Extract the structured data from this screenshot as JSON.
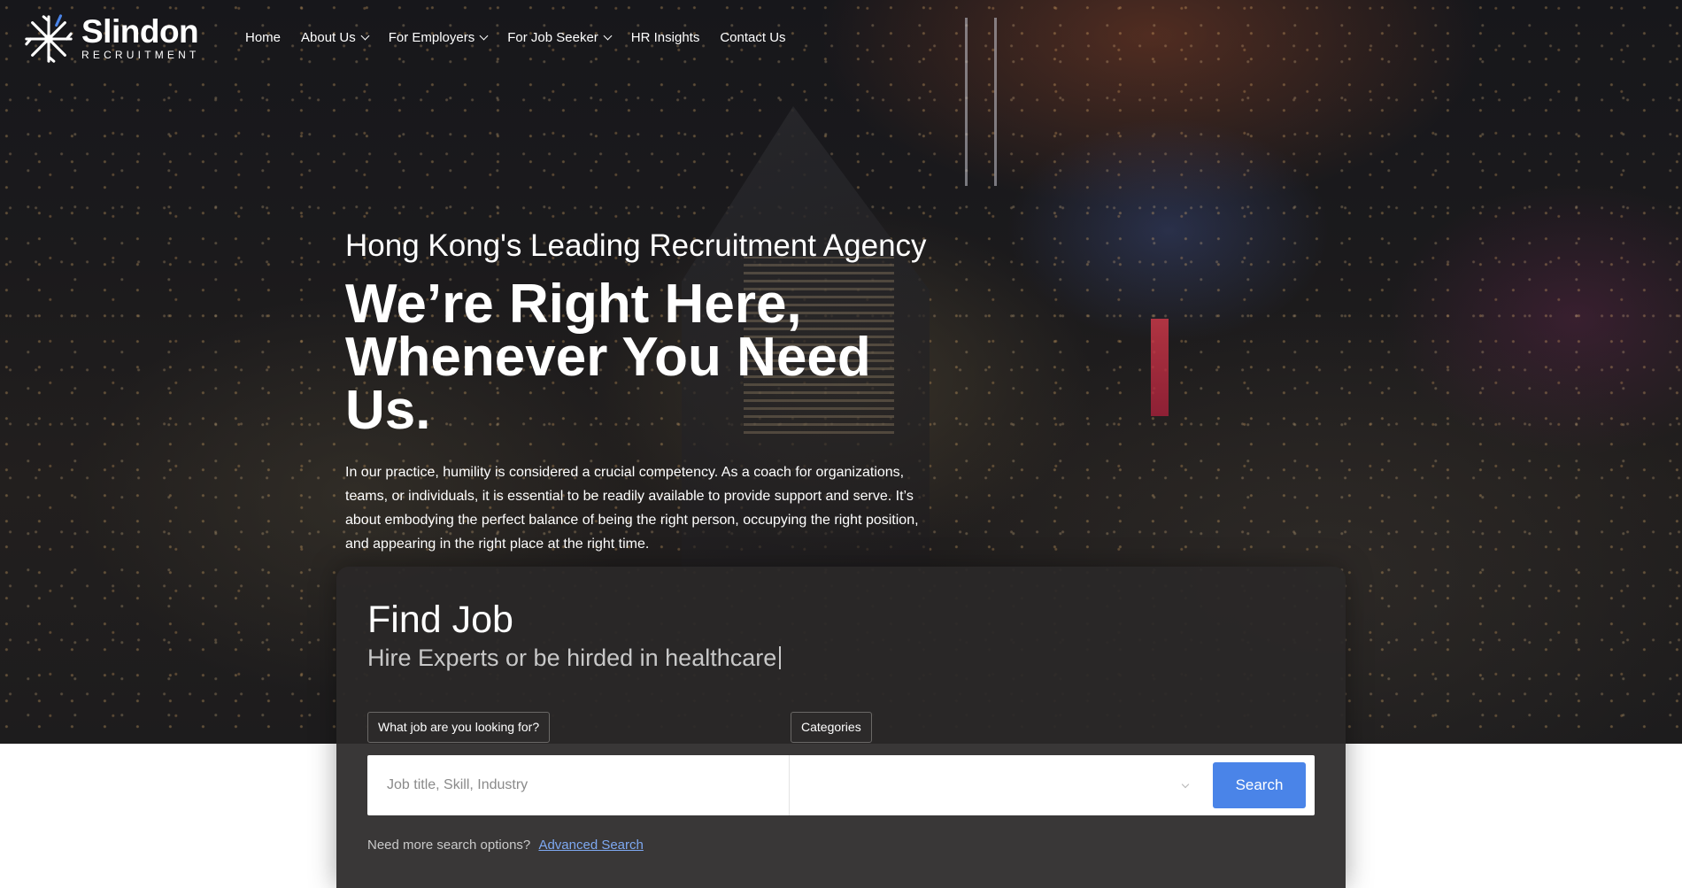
{
  "brand": {
    "name": "Slindon",
    "tagline": "RECRUITMENT",
    "logo_icon": "snowflake-burst-logo",
    "accent": "#4a84e8"
  },
  "nav": {
    "items": [
      {
        "label": "Home",
        "has_dropdown": false
      },
      {
        "label": "About Us",
        "has_dropdown": true
      },
      {
        "label": "For Employers",
        "has_dropdown": true
      },
      {
        "label": "For Job Seeker",
        "has_dropdown": true
      },
      {
        "label": "HR Insights",
        "has_dropdown": false
      },
      {
        "label": "Contact Us",
        "has_dropdown": false
      }
    ]
  },
  "hero": {
    "eyebrow": "Hong Kong's Leading Recruitment Agency",
    "headline_line1": "We’re Right Here,",
    "headline_line2": "Whenever You Need Us.",
    "intro": "In our practice, humility is considered a crucial competency. As a coach for organizations, teams, or individuals, it is essential to be readily available to provide support and serve. It’s about embodying the perfect balance of being the right person, occupying the right position, and appearing in the right place at the right time."
  },
  "find_job": {
    "title": "Find Job",
    "subtitle": "Hire Experts or be hirded in healthcare",
    "job_label": "What job are you looking for?",
    "categories_label": "Categories",
    "search_placeholder": "Job title, Skill, Industry",
    "search_value": "",
    "category_value": "",
    "search_button": "Search",
    "more_text": "Need more search options?",
    "advanced_link": "Advanced Search"
  }
}
